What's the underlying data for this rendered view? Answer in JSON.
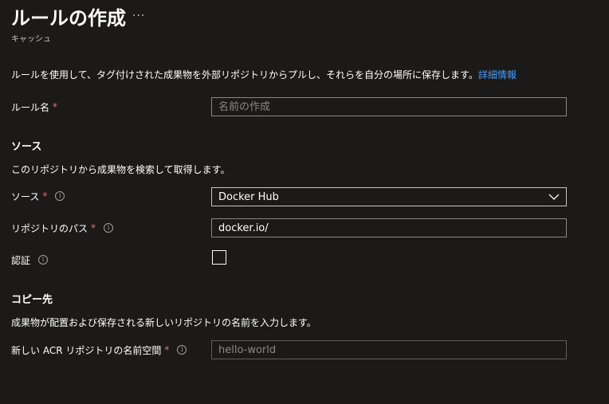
{
  "header": {
    "title": "ルールの作成",
    "more": "···",
    "subtitle": "キャッシュ"
  },
  "intro": {
    "text": "ルールを使用して、タグ付けされた成果物を外部リポジトリからプルし、それらを自分の場所に保存します。",
    "link": "詳細情報"
  },
  "rule_name": {
    "label": "ルール名",
    "required": "*",
    "placeholder": "名前の作成",
    "value": ""
  },
  "source": {
    "heading": "ソース",
    "description": "このリポジトリから成果物を検索して取得します。",
    "source_field": {
      "label": "ソース",
      "required": "*",
      "selected": "Docker Hub"
    },
    "repo_path": {
      "label": "リポジトリのパス",
      "required": "*",
      "value": "docker.io/"
    },
    "auth": {
      "label": "認証",
      "checked": false
    }
  },
  "destination": {
    "heading": "コピー先",
    "description": "成果物が配置および保存される新しいリポジトリの名前を入力します。",
    "namespace": {
      "label": "新しい ACR リポジトリの名前空間",
      "required": "*",
      "placeholder": "hello-world",
      "value": ""
    }
  },
  "icons": {
    "info": "info-icon",
    "chevron": "chevron-down-icon"
  },
  "colors": {
    "background": "#1b1a19",
    "link": "#479ef5",
    "required": "#f1707b"
  }
}
